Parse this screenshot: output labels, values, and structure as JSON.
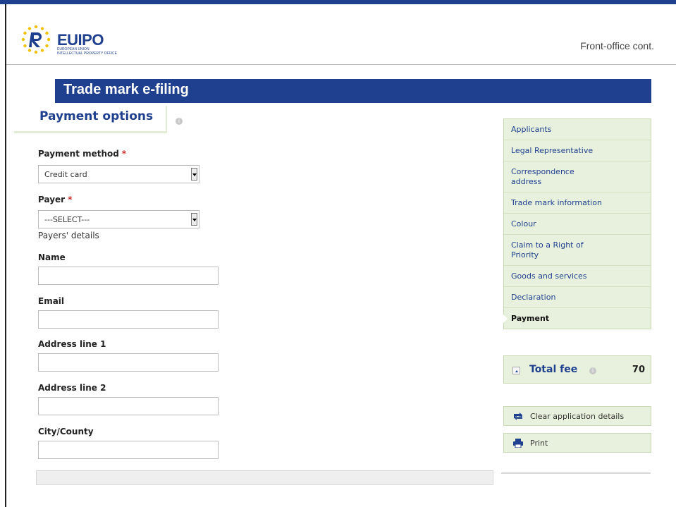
{
  "header": {
    "logo_main": "EUIPO",
    "logo_sub1": "European Union",
    "logo_sub2": "Intellectual Property Office",
    "right_text": "Front-office cont."
  },
  "banner": {
    "title": "Trade mark e-filing"
  },
  "section": {
    "title": "Payment options"
  },
  "form": {
    "payment_method_label": "Payment method",
    "payment_method_value": "Credit card",
    "payer_label": "Payer",
    "payer_value": "---SELECT---",
    "required_mark": "*",
    "payers_details": "Payers' details",
    "name_label": "Name",
    "email_label": "Email",
    "address1_label": "Address line 1",
    "address2_label": "Address line 2",
    "city_label": "City/County"
  },
  "sidebar": {
    "items": [
      {
        "label": "Applicants"
      },
      {
        "label": "Legal Representative"
      },
      {
        "label": "Correspondence address"
      },
      {
        "label": "Trade mark information"
      },
      {
        "label": "Colour"
      },
      {
        "label": "Claim to a Right of Priority"
      },
      {
        "label": "Goods and services"
      },
      {
        "label": "Declaration"
      },
      {
        "label": "Payment"
      }
    ]
  },
  "fee": {
    "label": "Total fee",
    "value": "70"
  },
  "actions": {
    "clear_label": "Clear application details",
    "print_label": "Print"
  },
  "colors": {
    "brand_blue": "#1f3f8f",
    "panel_green": "#e8f1dd",
    "required_red": "#d0312d"
  }
}
